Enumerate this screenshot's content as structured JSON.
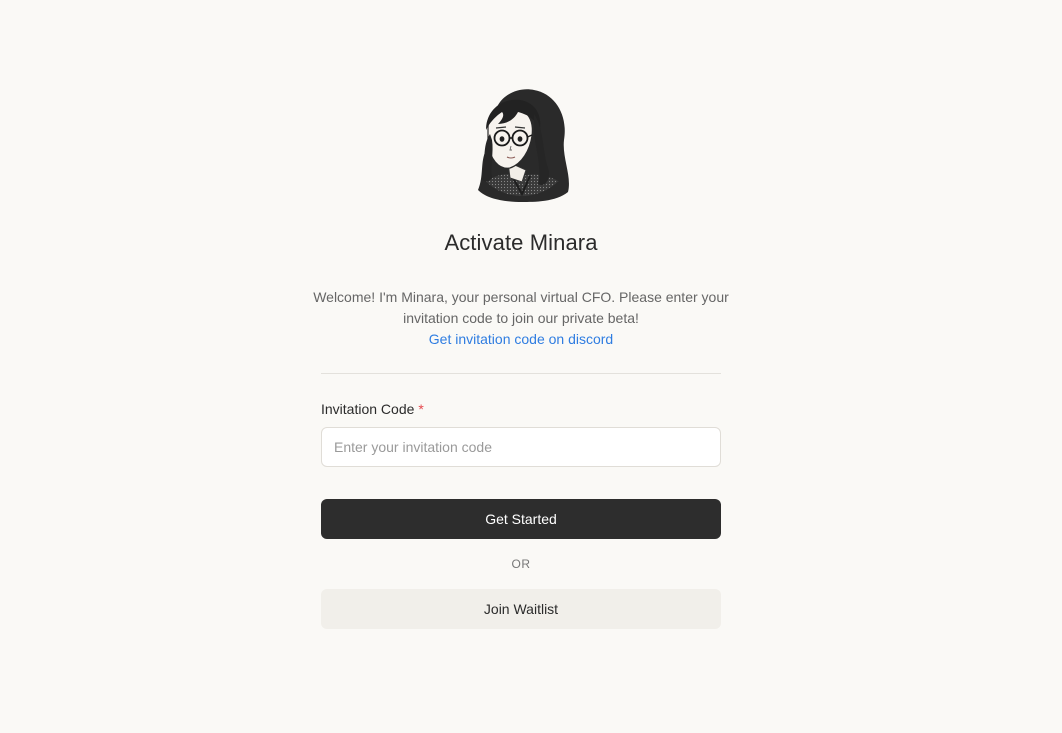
{
  "avatar": {
    "icon": "minara-avatar-portrait"
  },
  "heading": {
    "title": "Activate Minara"
  },
  "intro": {
    "message": "Welcome! I'm Minara, your personal virtual CFO. Please enter your invitation code to join our private beta!",
    "link_text": "Get invitation code on discord"
  },
  "form": {
    "label": "Invitation Code",
    "required_marker": "*",
    "input_value": "",
    "input_placeholder": "Enter your invitation code"
  },
  "actions": {
    "primary_label": "Get Started",
    "separator": "OR",
    "secondary_label": "Join Waitlist"
  },
  "colors": {
    "background": "#faf9f6",
    "primary_button": "#2d2d2d",
    "secondary_button": "#f1efea",
    "link": "#2f7de1",
    "required": "#e5484d"
  }
}
